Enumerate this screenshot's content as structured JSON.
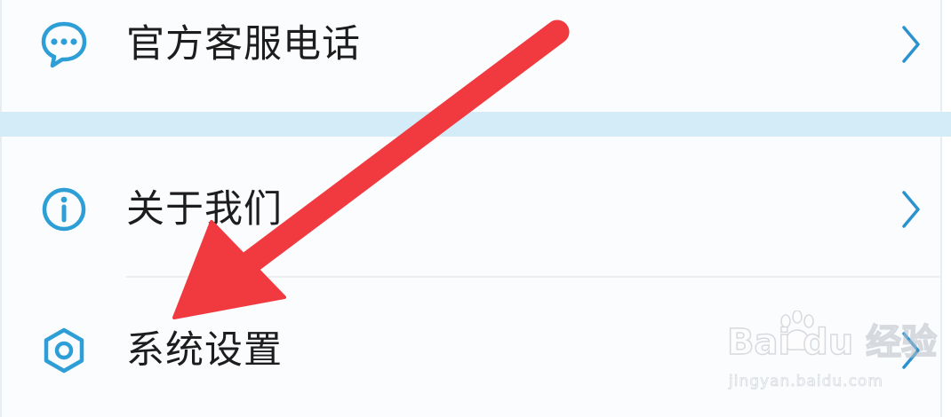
{
  "menu": {
    "items": [
      {
        "label": "官方客服电话",
        "icon": "chat-bubble-icon"
      },
      {
        "label": "关于我们",
        "icon": "info-icon"
      },
      {
        "label": "系统设置",
        "icon": "hexagon-settings-icon"
      }
    ],
    "chevron_icon": "chevron-right-icon"
  },
  "watermark": {
    "brand": "Bai du 经验",
    "url": "jingyan.baidu.com"
  },
  "annotation": {
    "arrow_color": "#f03a3f",
    "points_to": "系统设置"
  },
  "colors": {
    "icon_blue": "#2e9fd6",
    "chevron_blue": "#2a92cf",
    "separator": "#d3ecf8",
    "text": "#1d1d1d"
  }
}
